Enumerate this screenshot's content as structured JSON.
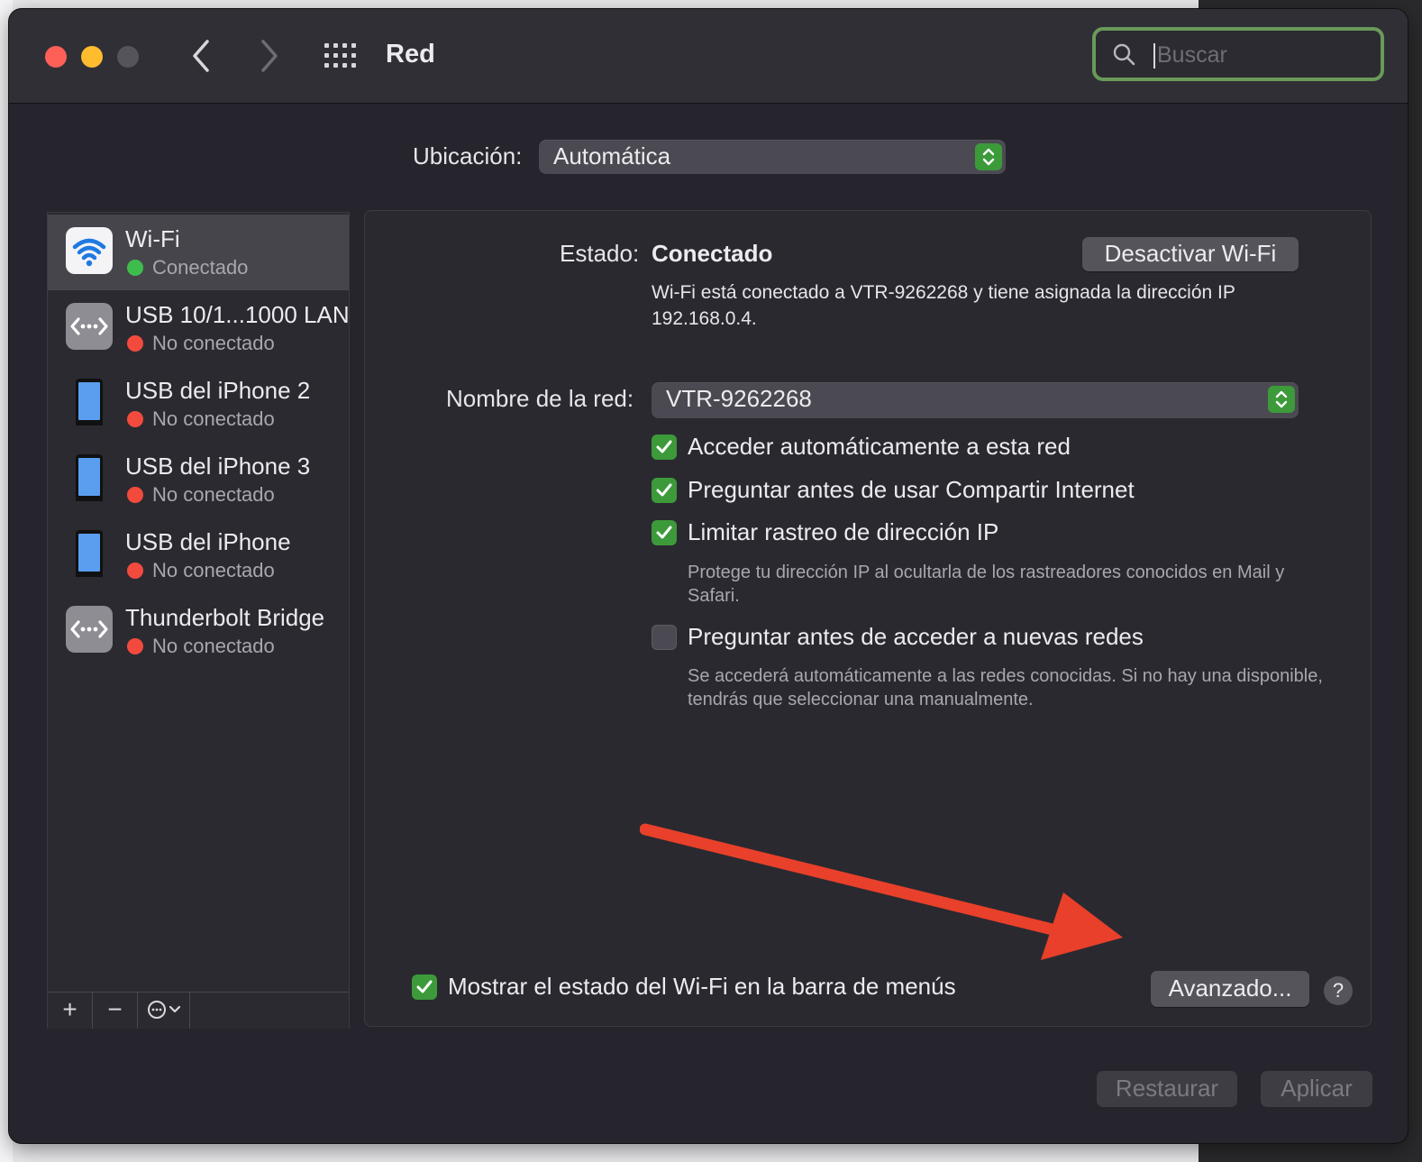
{
  "window": {
    "title": "Red",
    "search_placeholder": "Buscar"
  },
  "location": {
    "label": "Ubicación:",
    "value": "Automática"
  },
  "sidebar": {
    "services": [
      {
        "name": "Wi-Fi",
        "status": "Conectado",
        "icon": "wifi-icon",
        "status_color": "#3ebd4d"
      },
      {
        "name": "USB 10/1...1000 LAN",
        "status": "No conectado",
        "icon": "ethernet-icon",
        "status_color": "#f24b3d"
      },
      {
        "name": "USB del iPhone 2",
        "status": "No conectado",
        "icon": "iphone-icon",
        "status_color": "#f24b3d"
      },
      {
        "name": "USB del iPhone 3",
        "status": "No conectado",
        "icon": "iphone-icon",
        "status_color": "#f24b3d"
      },
      {
        "name": "USB del iPhone",
        "status": "No conectado",
        "icon": "iphone-icon",
        "status_color": "#f24b3d"
      },
      {
        "name": "Thunderbolt Bridge",
        "status": "No conectado",
        "icon": "ethernet-icon",
        "status_color": "#f24b3d"
      }
    ],
    "toolbar": {
      "add": "+",
      "remove": "−"
    }
  },
  "detail": {
    "status_label": "Estado:",
    "status_value": "Conectado",
    "deactivate_button": "Desactivar Wi-Fi",
    "status_description": "Wi-Fi está conectado a VTR-9262268 y tiene asignada la dirección IP 192.168.0.4.",
    "network_name_label": "Nombre de la red:",
    "network_name_value": "VTR-9262268",
    "options": [
      {
        "label": "Acceder automáticamente a esta red",
        "checked": true
      },
      {
        "label": "Preguntar antes de usar Compartir Internet",
        "checked": true
      },
      {
        "label": "Limitar rastreo de dirección IP",
        "checked": true
      },
      {
        "label": "Preguntar antes de acceder a nuevas redes",
        "checked": false
      }
    ],
    "hint_ip": "Protege tu dirección IP al ocultarla de los rastreadores conocidos en Mail y Safari.",
    "hint_networks": "Se accederá automáticamente a las redes conocidas. Si no hay una disponible, tendrás que seleccionar una manualmente.",
    "menubar_option": {
      "label": "Mostrar el estado del Wi-Fi en la barra de menús",
      "checked": true
    },
    "advanced_button": "Avanzado...",
    "help_button": "?"
  },
  "footer": {
    "restore_button": "Restaurar",
    "apply_button": "Aplicar"
  },
  "colors": {
    "accent_green": "#3c9a3a",
    "annotation_arrow": "#e8402a"
  }
}
